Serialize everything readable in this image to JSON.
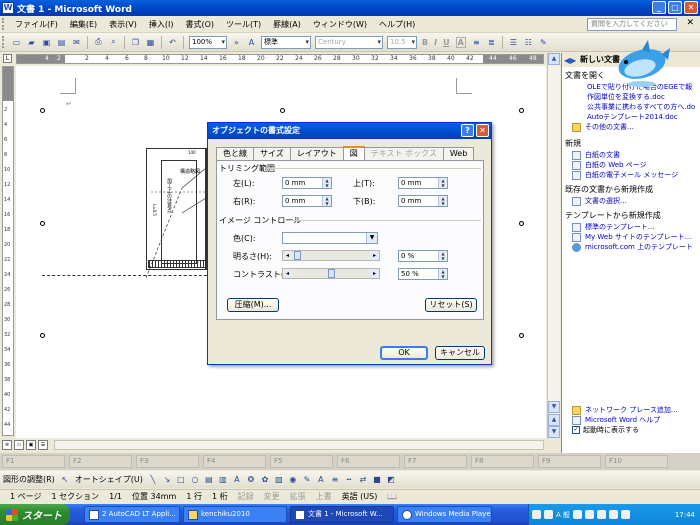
{
  "window": {
    "title": "文書 1 - Microsoft Word"
  },
  "menu": {
    "items": [
      "ファイル(F)",
      "編集(E)",
      "表示(V)",
      "挿入(I)",
      "書式(O)",
      "ツール(T)",
      "罫線(A)",
      "ウィンドウ(W)",
      "ヘルプ(H)"
    ],
    "help_placeholder": "質問を入力してください"
  },
  "toolbar": {
    "zoom": "100%",
    "style": "標準",
    "font": "Century",
    "font_size": "10.5",
    "bold": "B",
    "italic": "I",
    "underline": "U",
    "charborder": "A"
  },
  "ruler": {
    "ticks": [
      "4",
      "2",
      "2",
      "4",
      "6",
      "8",
      "10",
      "12",
      "14",
      "16",
      "18",
      "20",
      "22",
      "24",
      "26",
      "28",
      "30",
      "32",
      "34",
      "36",
      "38",
      "40",
      "42",
      "44",
      "46",
      "48"
    ]
  },
  "vruler": {
    "ticks": [
      "2",
      "4",
      "6",
      "8",
      "10",
      "12",
      "14",
      "16",
      "18",
      "20",
      "22",
      "24",
      "26",
      "28",
      "30",
      "32",
      "34",
      "36",
      "38",
      "40",
      "42",
      "44",
      "46"
    ]
  },
  "drawing": {
    "label1": "構造略図",
    "label2": "加工上の注意点",
    "dim1": "140",
    "dim2": "L=0.5"
  },
  "taskpane": {
    "title": "新しい文書",
    "open_section": "文書を開く",
    "recent": [
      "OLEで貼り付けた場合のEGEで報",
      "作図単位を変換する.doc",
      "公共事業に携わるすべての方へ.do",
      "Autoテンプレート2014.doc"
    ],
    "other_docs": "その他の文書...",
    "new_section": "新規",
    "new_items": [
      "白紙の文書",
      "白紙の Web ページ",
      "白紙の電子メール メッセージ"
    ],
    "existing_section": "既存の文書から新規作成",
    "choose_doc": "文書の選択...",
    "template_section": "テンプレートから新規作成",
    "templates": [
      "標準のテンプレート...",
      "My Web サイトのテンプレート...",
      "microsoft.com 上のテンプレート"
    ],
    "network": "ネットワーク プレース追加...",
    "help": "Microsoft Word ヘルプ",
    "show_at_startup": "起動時に表示する"
  },
  "dialog": {
    "title": "オブジェクトの書式設定",
    "tabs": [
      "色と線",
      "サイズ",
      "レイアウト",
      "図",
      "テキスト ボックス",
      "Web"
    ],
    "trim_group": "トリミング範囲",
    "left_label": "左(L):",
    "left_value": "0 mm",
    "top_label": "上(T):",
    "top_value": "0 mm",
    "right_label": "右(R):",
    "right_value": "0 mm",
    "bottom_label": "下(B):",
    "bottom_value": "0 mm",
    "image_group": "イメージ コントロール",
    "color_label": "色(C):",
    "brightness_label": "明るさ(H):",
    "brightness_value": "0 %",
    "contrast_label": "コントラスト(N):",
    "contrast_value": "50 %",
    "compress": "圧縮(M)...",
    "reset": "リセット(S)",
    "ok": "OK",
    "cancel": "キャンセル"
  },
  "fkeys": [
    "F1",
    "F2",
    "F3",
    "F4",
    "F5",
    "F6",
    "F7",
    "F8",
    "F9",
    "F10"
  ],
  "drawbar": {
    "adjust": "図形の調整(R)",
    "autoshape": "オートシェイプ(U)"
  },
  "status": {
    "page": "1 ページ",
    "section": "1 セクション",
    "pages": "1/1",
    "position": "位置 34mm",
    "line": "1 行",
    "col": "1 桁",
    "rec": "記録",
    "trk": "変更",
    "ext": "拡張",
    "ovr": "上書",
    "lang": "英語 (US)"
  },
  "taskbar": {
    "start": "スタート",
    "tasks": [
      "2 AutoCAD LT Appli...",
      "kenchiku2010",
      "文書 1 - Microsoft W...",
      "Windows Media Player"
    ],
    "ime": "A 般",
    "clock": "17:44"
  }
}
